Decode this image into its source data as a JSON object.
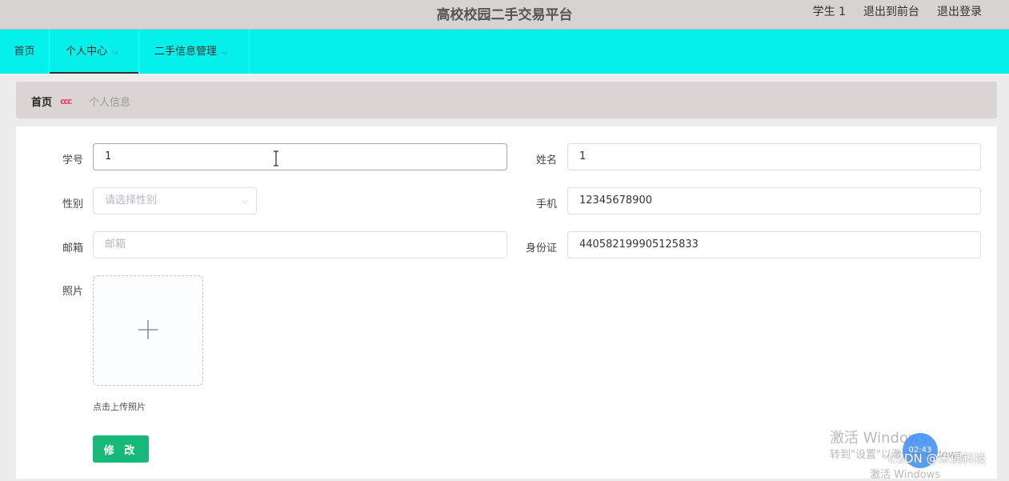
{
  "header": {
    "title": "高校校园二手交易平台",
    "user": "学生 1",
    "to_front": "退出到前台",
    "logout": "退出登录"
  },
  "nav": {
    "items": [
      {
        "label": "首页"
      },
      {
        "label": "个人中心"
      },
      {
        "label": "二手信息管理"
      }
    ]
  },
  "breadcrumb": {
    "home": "首页",
    "separator": "ccc",
    "current": "个人信息"
  },
  "form": {
    "student_id": {
      "label": "学号",
      "value": "1"
    },
    "name": {
      "label": "姓名",
      "value": "1"
    },
    "gender": {
      "label": "性别",
      "placeholder": "请选择性别"
    },
    "phone": {
      "label": "手机",
      "value": "12345678900"
    },
    "email": {
      "label": "邮箱",
      "placeholder": "邮箱"
    },
    "id_card": {
      "label": "身份证",
      "value": "440582199905125833"
    },
    "photo": {
      "label": "照片",
      "hint": "点击上传照片"
    },
    "submit_label": "修 改"
  },
  "overlay": {
    "watermark_line1": "激活 Windows",
    "watermark_line2": "转到\"设置\"以激活 Windows。",
    "watermark_line3": "激活 Windows",
    "csdn": "CSDN @米偶科技",
    "fab": "02:43"
  },
  "colors": {
    "nav_bg": "#05f0ea",
    "topbar_bg": "#d8d3d3",
    "submit_bg": "#17b978"
  }
}
